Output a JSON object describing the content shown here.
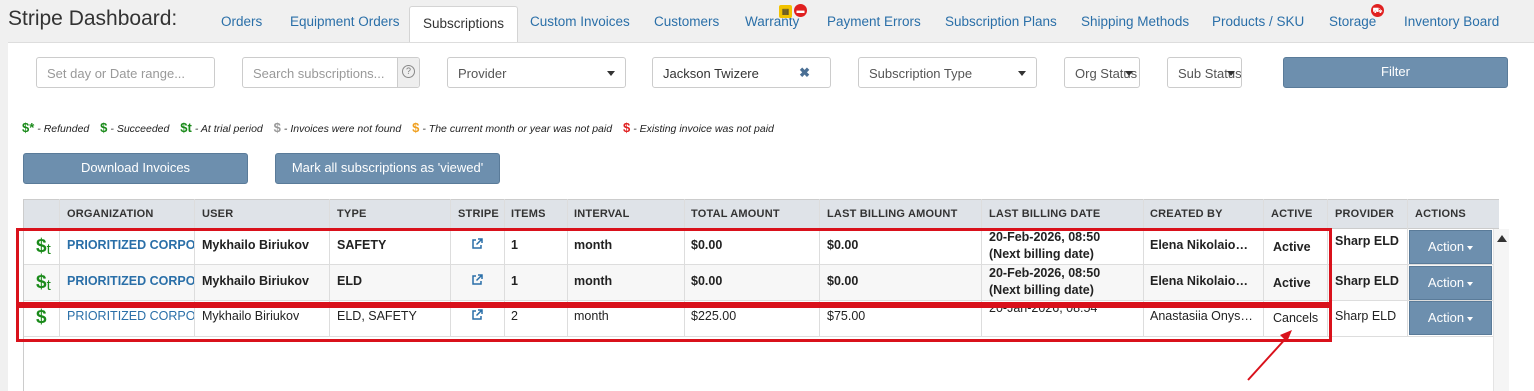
{
  "header": {
    "title": "Stripe Dashboard:",
    "tabs": [
      {
        "label": "Orders",
        "active": false
      },
      {
        "label": "Equipment Orders",
        "active": false
      },
      {
        "label": "Subscriptions",
        "active": true
      },
      {
        "label": "Custom Invoices",
        "active": false
      },
      {
        "label": "Customers",
        "active": false
      },
      {
        "label": "Warranty",
        "active": false
      },
      {
        "label": "Payment Errors",
        "active": false
      },
      {
        "label": "Subscription Plans",
        "active": false
      },
      {
        "label": "Shipping Methods",
        "active": false
      },
      {
        "label": "Products / SKU",
        "active": false
      },
      {
        "label": "Storage",
        "active": false
      },
      {
        "label": "Inventory Board",
        "active": false
      }
    ]
  },
  "filters": {
    "date_placeholder": "Set day or Date range...",
    "search_placeholder": "Search subscriptions...",
    "help_icon": "?",
    "provider": "Provider",
    "user": "Jackson Twizere",
    "clear_icon": "✖",
    "subscription_type": "Subscription Type",
    "org_status": "Org Status",
    "sub_status": "Sub Status",
    "filter_button": "Filter"
  },
  "legend": [
    {
      "symbol": "$*",
      "text": "- Refunded",
      "color": "#1a8a1a"
    },
    {
      "symbol": "$",
      "text": "- Succeeded",
      "color": "#1a8a1a"
    },
    {
      "symbol": "$t",
      "text": "- At trial period",
      "color": "#1a8a1a"
    },
    {
      "symbol": "$",
      "text": "- Invoices were not found",
      "color": "#999999"
    },
    {
      "symbol": "$",
      "text": "- The current month or year was not paid",
      "color": "#f0a020"
    },
    {
      "symbol": "$",
      "text": "- Existing invoice was not paid",
      "color": "#e02020"
    }
  ],
  "buttons": {
    "download": "Download Invoices",
    "mark_viewed": "Mark all subscriptions as 'viewed'"
  },
  "table": {
    "columns": [
      "ORGANIZATION",
      "USER",
      "TYPE",
      "STRIPE",
      "ITEMS",
      "INTERVAL",
      "TOTAL AMOUNT",
      "LAST BILLING AMOUNT",
      "LAST BILLING DATE",
      "CREATED BY",
      "ACTIVE",
      "PROVIDER",
      "ACTIONS"
    ],
    "rows": [
      {
        "status": "$",
        "status_suffix": "t",
        "organization": "PRIORITIZED CORPO",
        "user": "Mykhailo Biriukov",
        "type": "SAFETY",
        "items": "1",
        "interval": "month",
        "total": "$0.00",
        "last_amount": "$0.00",
        "last_date": "20-Feb-2026, 08:50",
        "last_date_note": "(Next billing date)",
        "created_by": "Elena Nikolaio…",
        "active": "Active",
        "provider": "Sharp ELD",
        "action": "Action"
      },
      {
        "status": "$",
        "status_suffix": "t",
        "organization": "PRIORITIZED CORPO",
        "user": "Mykhailo Biriukov",
        "type": "ELD",
        "items": "1",
        "interval": "month",
        "total": "$0.00",
        "last_amount": "$0.00",
        "last_date": "20-Feb-2026, 08:50",
        "last_date_note": "(Next billing date)",
        "created_by": "Elena Nikolaio…",
        "active": "Active",
        "provider": "Sharp ELD",
        "action": "Action"
      },
      {
        "status": "$",
        "status_suffix": "",
        "organization": "PRIORITIZED CORPO",
        "user": "Mykhailo Biriukov",
        "type": "ELD, SAFETY",
        "items": "2",
        "interval": "month",
        "total": "$225.00",
        "last_amount": "$75.00",
        "last_date": "20-Jan-2026, 08:54",
        "last_date_note": "",
        "created_by": "Anastasiia Onys…",
        "active": "Cancels",
        "provider": "Sharp ELD",
        "action": "Action"
      }
    ]
  },
  "colors": {
    "accent": "#6d8fae",
    "link": "#2a6fa8",
    "highlight": "#d9111b",
    "success": "#1a8a1a"
  }
}
